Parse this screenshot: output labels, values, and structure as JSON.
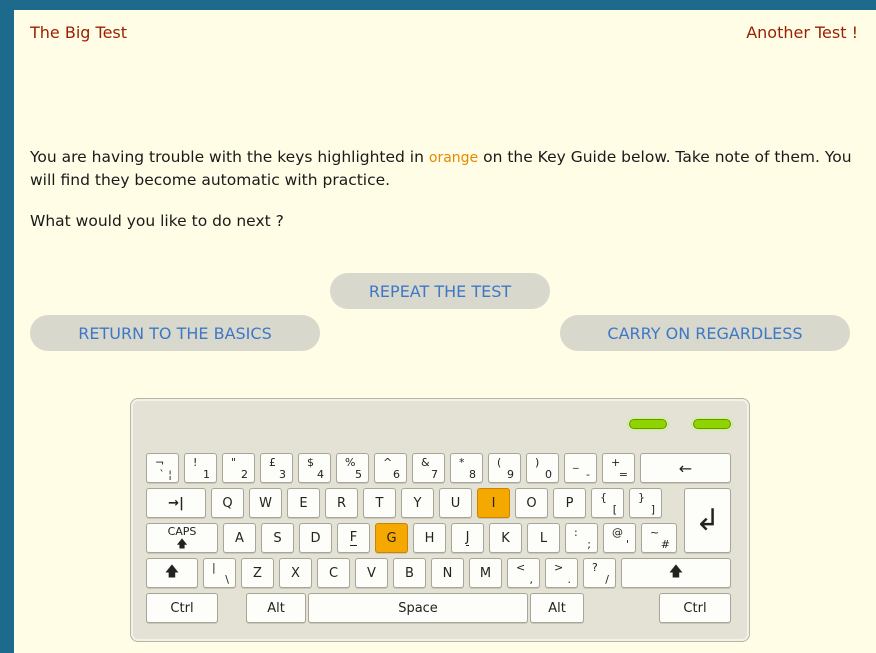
{
  "header": {
    "left_title": "The Big Test",
    "right_title": "Another Test !"
  },
  "message": {
    "part1": "You are having trouble with the keys highlighted in ",
    "highlight_word": "orange",
    "part2": " on the Key Guide below. Take note of them. You will find they become automatic with practice.",
    "question": "What would you like to do next ?"
  },
  "buttons": {
    "repeat": "REPEAT THE TEST",
    "basics": "RETURN TO THE BASICS",
    "carry": "CARRY ON REGARDLESS"
  },
  "colors": {
    "frame": "#1e6a8c",
    "background": "#fffde5",
    "header_text": "#9a1f00",
    "highlight": "#f5a800",
    "button_text": "#3d78c8",
    "led": "#8fd400"
  },
  "keyboard": {
    "highlighted_keys": [
      "I",
      "G"
    ],
    "row1": [
      {
        "top": "¬",
        "bottom": "` ¦"
      },
      {
        "top": "!",
        "bottom": "1"
      },
      {
        "top": "\"",
        "bottom": "2"
      },
      {
        "top": "£",
        "bottom": "3"
      },
      {
        "top": "$",
        "bottom": "4"
      },
      {
        "top": "%",
        "bottom": "5"
      },
      {
        "top": "^",
        "bottom": "6"
      },
      {
        "top": "&",
        "bottom": "7"
      },
      {
        "top": "*",
        "bottom": "8"
      },
      {
        "top": "(",
        "bottom": "9"
      },
      {
        "top": ")",
        "bottom": "0"
      },
      {
        "top": "_",
        "bottom": "-"
      },
      {
        "top": "+",
        "bottom": "="
      }
    ],
    "backspace": "←",
    "tab": "→|",
    "row2": [
      "Q",
      "W",
      "E",
      "R",
      "T",
      "Y",
      "U",
      "I",
      "O",
      "P"
    ],
    "row2_extra": [
      {
        "top": "{",
        "bottom": "["
      },
      {
        "top": "}",
        "bottom": "]"
      }
    ],
    "enter": "↲",
    "caps": {
      "label": "CAPS",
      "arrow": "🡅"
    },
    "row3": [
      "A",
      "S",
      "D",
      "F",
      "G",
      "H",
      "J",
      "K",
      "L"
    ],
    "row3_extra": [
      {
        "top": ":",
        "bottom": ";"
      },
      {
        "top": "@",
        "bottom": "'"
      },
      {
        "top": "~",
        "bottom": "#"
      }
    ],
    "shift": "🡅",
    "row4_first": {
      "top": "|",
      "bottom": "\\"
    },
    "row4": [
      "Z",
      "X",
      "C",
      "V",
      "B",
      "N",
      "M"
    ],
    "row4_extra": [
      {
        "top": "<",
        "bottom": ","
      },
      {
        "top": ">",
        "bottom": "."
      },
      {
        "top": "?",
        "bottom": "/"
      }
    ],
    "bottom": {
      "ctrl": "Ctrl",
      "alt": "Alt",
      "space": "Space"
    }
  }
}
